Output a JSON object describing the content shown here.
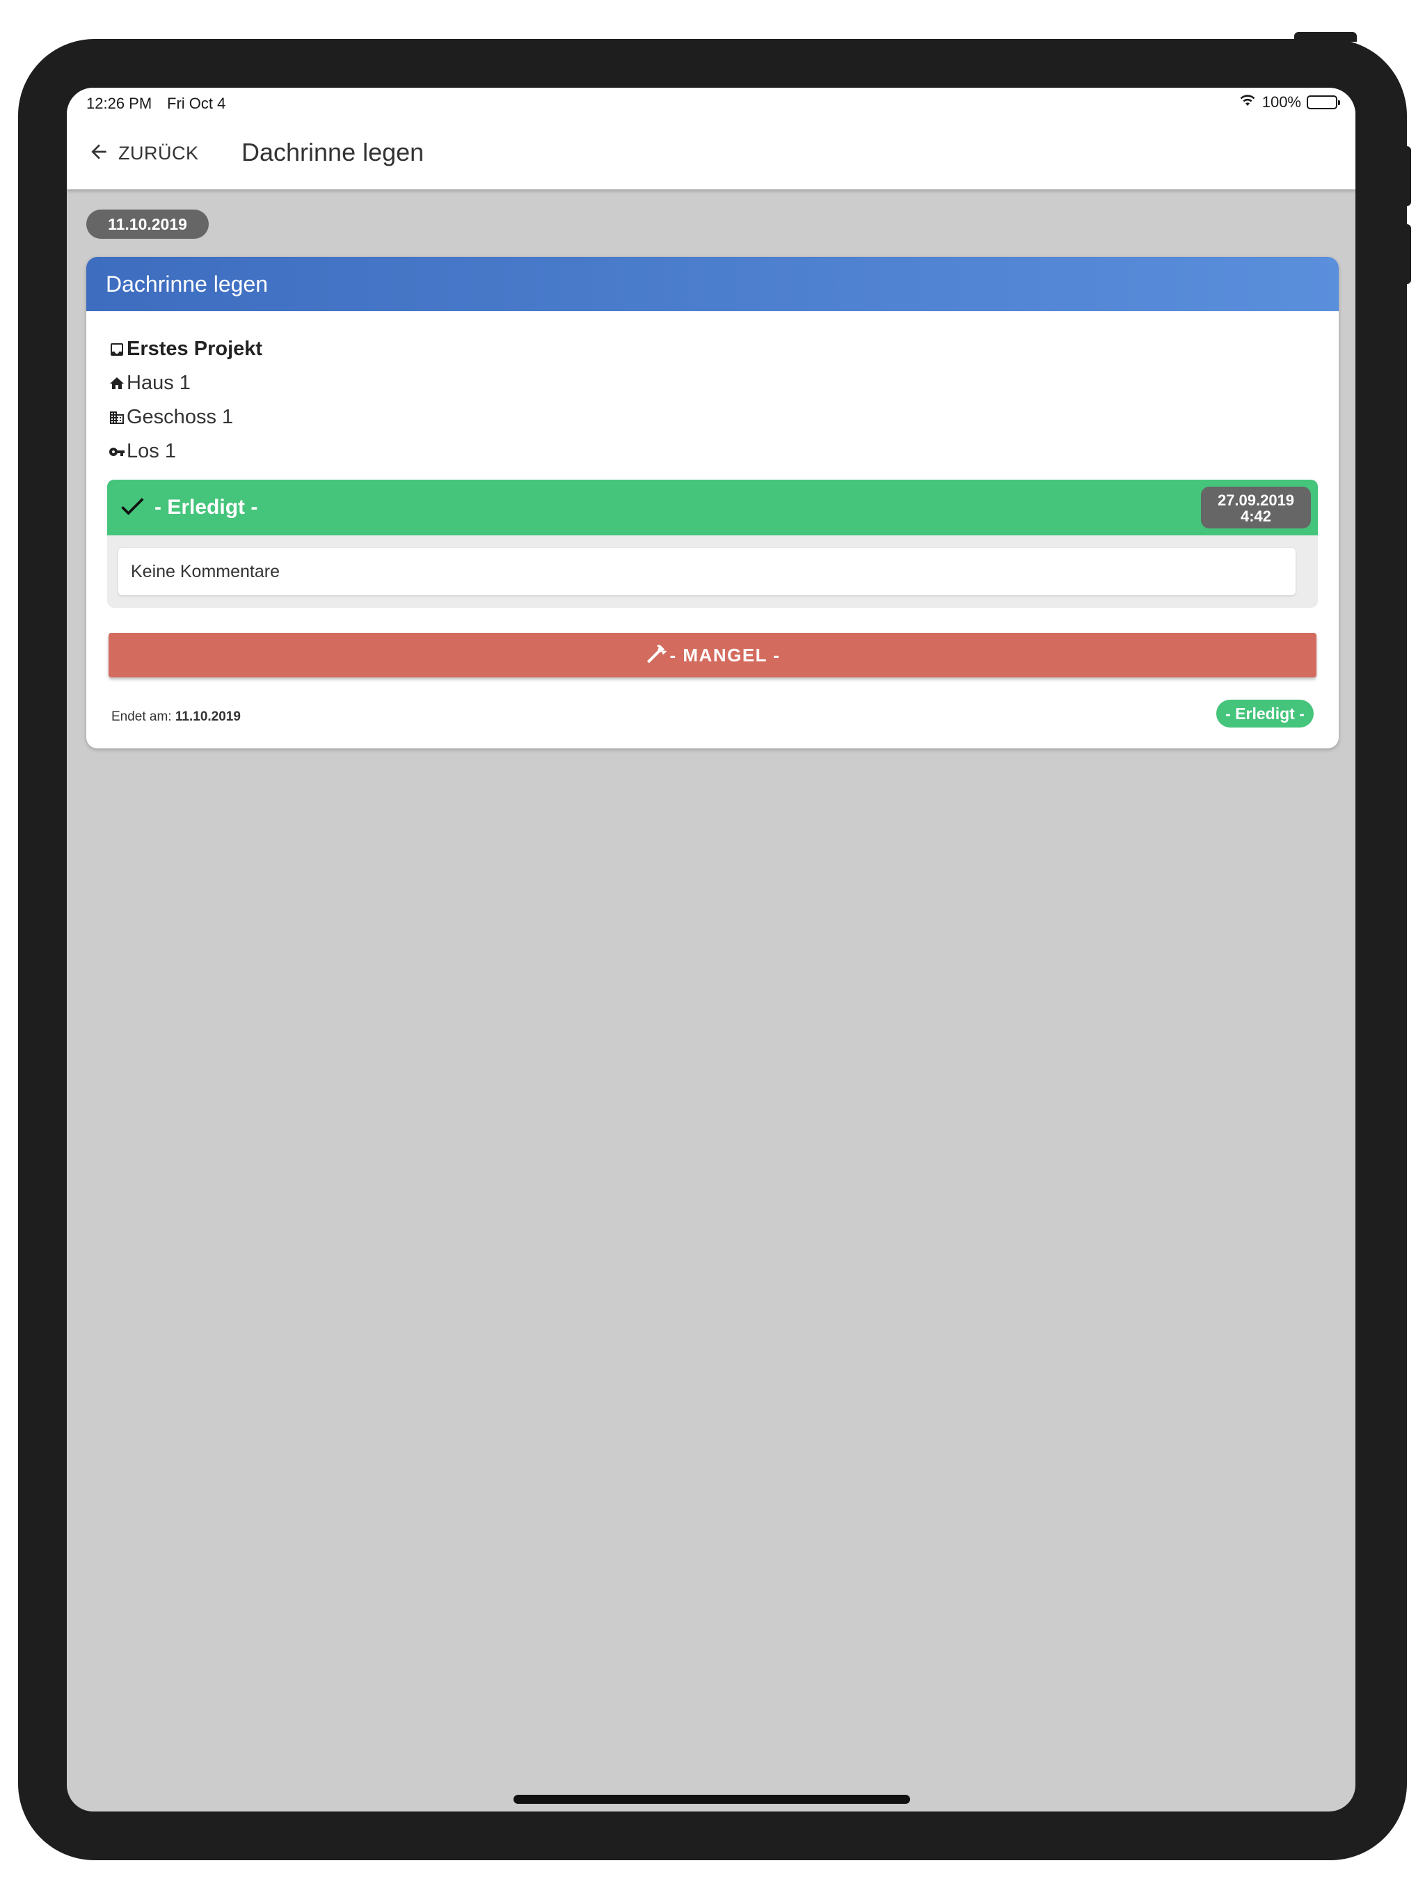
{
  "status_bar": {
    "time": "12:26 PM",
    "date": "Fri Oct 4",
    "battery": "100%"
  },
  "header": {
    "back_label": "ZURÜCK",
    "title": "Dachrinne legen"
  },
  "date_chip": "11.10.2019",
  "card": {
    "title": "Dachrinne legen",
    "project": "Erstes Projekt",
    "house": "Haus 1",
    "floor": "Geschoss 1",
    "lot": "Los 1",
    "status": {
      "label": "- Erledigt -",
      "date": "27.09.2019",
      "time": "4:42",
      "color": "#45c47b"
    },
    "comment": "Keine Kommentare",
    "mangel_label": "- MANGEL -",
    "mangel_color": "#d36b5e",
    "ends_label": "Endet am:",
    "ends_date": "11.10.2019",
    "done_badge": "- Erledigt -"
  },
  "colors": {
    "header_gradient_start": "#3e6dbf",
    "header_gradient_end": "#5a8fdc",
    "background": "#cccccc"
  }
}
